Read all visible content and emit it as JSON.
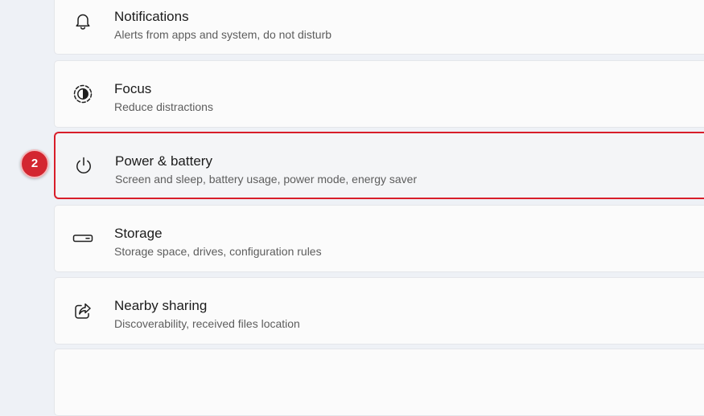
{
  "settings_items": [
    {
      "title": "Notifications",
      "subtitle": "Alerts from apps and system, do not disturb",
      "icon": "bell-icon"
    },
    {
      "title": "Focus",
      "subtitle": "Reduce distractions",
      "icon": "focus-icon"
    },
    {
      "title": "Power & battery",
      "subtitle": "Screen and sleep, battery usage, power mode, energy saver",
      "icon": "power-icon"
    },
    {
      "title": "Storage",
      "subtitle": "Storage space, drives, configuration rules",
      "icon": "storage-drive-icon"
    },
    {
      "title": "Nearby sharing",
      "subtitle": "Discoverability, received files location",
      "icon": "share-icon"
    }
  ],
  "annotation": {
    "step_label": "2",
    "color": "#d32630"
  },
  "colors": {
    "highlight_border": "#d81e2a",
    "card_background": "#fbfbfb",
    "page_background": "#eef1f6"
  }
}
